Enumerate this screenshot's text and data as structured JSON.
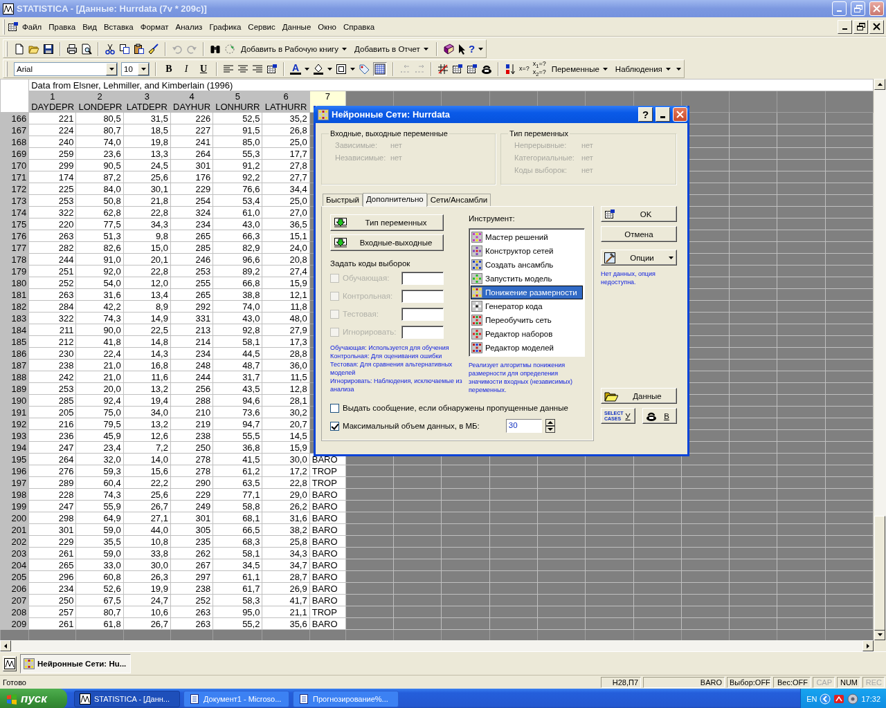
{
  "window": {
    "title": "STATISTICA - [Данные: Hurrdata (7v * 209c)]"
  },
  "menu": [
    "Файл",
    "Правка",
    "Вид",
    "Вставка",
    "Формат",
    "Анализ",
    "Графика",
    "Сервис",
    "Данные",
    "Окно",
    "Справка"
  ],
  "toolbar": {
    "add_to_workbook": "Добавить в Рабочую книгу",
    "add_to_report": "Добавить в Отчет",
    "help_mark": "?",
    "font": "Arial",
    "font_size": "10",
    "format_buttons": [
      "B",
      "I",
      "U"
    ],
    "font_color_letter": "A",
    "gridlines": {
      "on": true
    },
    "formula_buttons": [
      "x=?",
      "x$_{1}$=?",
      "x$_{2}$=?"
    ],
    "variables": "Переменные",
    "cases": "Наблюдения"
  },
  "sheet": {
    "caption": "Data from Elsner, Lehmiller, and Kimberlain (1996)",
    "columns": [
      {
        "number": "1",
        "name": "DAYDEPR"
      },
      {
        "number": "2",
        "name": "LONDEPR"
      },
      {
        "number": "3",
        "name": "LATDEPR"
      },
      {
        "number": "4",
        "name": "DAYHUR"
      },
      {
        "number": "5",
        "name": "LONHURR"
      },
      {
        "number": "6",
        "name": "LATHURR"
      },
      {
        "number": "7",
        "selected": true
      }
    ],
    "rows": [
      {
        "label": "166",
        "cells": [
          "221",
          "80,5",
          "31,5",
          "226",
          "52,5",
          "35,2"
        ]
      },
      {
        "label": "167",
        "cells": [
          "224",
          "80,7",
          "18,5",
          "227",
          "91,5",
          "26,8"
        ]
      },
      {
        "label": "168",
        "cells": [
          "240",
          "74,0",
          "19,8",
          "241",
          "85,0",
          "25,0"
        ]
      },
      {
        "label": "169",
        "cells": [
          "259",
          "23,6",
          "13,3",
          "264",
          "55,3",
          "17,7"
        ]
      },
      {
        "label": "170",
        "cells": [
          "299",
          "90,5",
          "24,5",
          "301",
          "91,2",
          "27,8"
        ]
      },
      {
        "label": "171",
        "cells": [
          "174",
          "87,2",
          "25,6",
          "176",
          "92,2",
          "27,7"
        ]
      },
      {
        "label": "172",
        "cells": [
          "225",
          "84,0",
          "30,1",
          "229",
          "76,6",
          "34,4"
        ]
      },
      {
        "label": "173",
        "cells": [
          "253",
          "50,8",
          "21,8",
          "254",
          "53,4",
          "25,0"
        ]
      },
      {
        "label": "174",
        "cells": [
          "322",
          "62,8",
          "22,8",
          "324",
          "61,0",
          "27,0"
        ]
      },
      {
        "label": "175",
        "cells": [
          "220",
          "77,5",
          "34,3",
          "234",
          "43,0",
          "36,5"
        ]
      },
      {
        "label": "176",
        "cells": [
          "263",
          "51,3",
          "9,8",
          "265",
          "66,3",
          "15,1"
        ]
      },
      {
        "label": "177",
        "cells": [
          "282",
          "82,6",
          "15,0",
          "285",
          "82,9",
          "24,0"
        ]
      },
      {
        "label": "178",
        "cells": [
          "244",
          "91,0",
          "20,1",
          "246",
          "96,6",
          "20,8"
        ]
      },
      {
        "label": "179",
        "cells": [
          "251",
          "92,0",
          "22,8",
          "253",
          "89,2",
          "27,4"
        ]
      },
      {
        "label": "180",
        "cells": [
          "252",
          "54,0",
          "12,0",
          "255",
          "66,8",
          "15,9"
        ]
      },
      {
        "label": "181",
        "cells": [
          "263",
          "31,6",
          "13,4",
          "265",
          "38,8",
          "12,1"
        ]
      },
      {
        "label": "182",
        "cells": [
          "284",
          "42,2",
          "8,9",
          "292",
          "74,0",
          "11,8"
        ]
      },
      {
        "label": "183",
        "cells": [
          "322",
          "74,3",
          "14,9",
          "331",
          "43,0",
          "48,0"
        ]
      },
      {
        "label": "184",
        "cells": [
          "211",
          "90,0",
          "22,5",
          "213",
          "92,8",
          "27,9"
        ]
      },
      {
        "label": "185",
        "cells": [
          "212",
          "41,8",
          "14,8",
          "214",
          "58,1",
          "17,3"
        ]
      },
      {
        "label": "186",
        "cells": [
          "230",
          "22,4",
          "14,3",
          "234",
          "44,5",
          "28,8"
        ]
      },
      {
        "label": "187",
        "cells": [
          "238",
          "21,0",
          "16,8",
          "248",
          "48,7",
          "36,0"
        ]
      },
      {
        "label": "188",
        "cells": [
          "242",
          "21,0",
          "11,6",
          "244",
          "31,7",
          "11,5"
        ]
      },
      {
        "label": "189",
        "cells": [
          "253",
          "20,0",
          "13,2",
          "256",
          "43,5",
          "12,8"
        ]
      },
      {
        "label": "190",
        "cells": [
          "285",
          "92,4",
          "19,4",
          "288",
          "94,6",
          "28,1"
        ]
      },
      {
        "label": "191",
        "cells": [
          "205",
          "75,0",
          "34,0",
          "210",
          "73,6",
          "30,2"
        ]
      },
      {
        "label": "192",
        "cells": [
          "216",
          "79,5",
          "13,2",
          "219",
          "94,7",
          "20,7"
        ]
      },
      {
        "label": "193",
        "cells": [
          "236",
          "45,9",
          "12,6",
          "238",
          "55,5",
          "14,5"
        ]
      },
      {
        "label": "194",
        "cells": [
          "247",
          "23,4",
          "7,2",
          "250",
          "36,8",
          "15,9"
        ]
      },
      {
        "label": "195",
        "cells": [
          "264",
          "32,0",
          "14,0",
          "278",
          "41,5",
          "30,0",
          "BARO"
        ]
      },
      {
        "label": "196",
        "cells": [
          "276",
          "59,3",
          "15,6",
          "278",
          "61,2",
          "17,2",
          "TROP"
        ]
      },
      {
        "label": "197",
        "cells": [
          "289",
          "60,4",
          "22,2",
          "290",
          "63,5",
          "22,8",
          "TROP"
        ]
      },
      {
        "label": "198",
        "cells": [
          "228",
          "74,3",
          "25,6",
          "229",
          "77,1",
          "29,0",
          "BARO"
        ]
      },
      {
        "label": "199",
        "cells": [
          "247",
          "55,9",
          "26,7",
          "249",
          "58,8",
          "26,2",
          "BARO"
        ]
      },
      {
        "label": "200",
        "cells": [
          "298",
          "64,9",
          "27,1",
          "301",
          "68,1",
          "31,6",
          "BARO"
        ]
      },
      {
        "label": "201",
        "cells": [
          "301",
          "59,0",
          "44,0",
          "305",
          "66,5",
          "38,2",
          "BARO"
        ]
      },
      {
        "label": "202",
        "cells": [
          "229",
          "35,5",
          "10,8",
          "235",
          "68,3",
          "25,8",
          "BARO"
        ]
      },
      {
        "label": "203",
        "cells": [
          "261",
          "59,0",
          "33,8",
          "262",
          "58,1",
          "34,3",
          "BARO"
        ]
      },
      {
        "label": "204",
        "cells": [
          "265",
          "33,0",
          "30,0",
          "267",
          "34,5",
          "34,7",
          "BARO"
        ]
      },
      {
        "label": "205",
        "cells": [
          "296",
          "60,8",
          "26,3",
          "297",
          "61,1",
          "28,7",
          "BARO"
        ]
      },
      {
        "label": "206",
        "cells": [
          "234",
          "52,6",
          "19,9",
          "238",
          "61,7",
          "26,9",
          "BARO"
        ]
      },
      {
        "label": "207",
        "cells": [
          "250",
          "67,5",
          "24,7",
          "252",
          "58,3",
          "41,7",
          "BARO"
        ]
      },
      {
        "label": "208",
        "cells": [
          "257",
          "80,7",
          "10,6",
          "263",
          "95,0",
          "21,1",
          "TROP"
        ]
      },
      {
        "label": "209",
        "cells": [
          "261",
          "61,8",
          "26,7",
          "263",
          "55,2",
          "35,6",
          "BARO"
        ]
      }
    ]
  },
  "dialog": {
    "title": "Нейронные Сети: Hurrdata",
    "help_button": "?",
    "io_group": {
      "title": "Входные, выходные переменные",
      "fields": [
        {
          "label": "Зависимые:",
          "value": "нет",
          "disabled": true
        },
        {
          "label": "Независимые:",
          "value": "нет",
          "disabled": true
        }
      ]
    },
    "type_group": {
      "title": "Тип переменных",
      "fields": [
        {
          "label": "Непрерывные:",
          "value": "нет",
          "disabled": true
        },
        {
          "label": "Категориальные:",
          "value": "нет",
          "disabled": true
        },
        {
          "label": "Коды выборок:",
          "value": "нет",
          "disabled": true
        }
      ]
    },
    "tabs": [
      {
        "label": "Быстрый",
        "selected": false
      },
      {
        "label": "Дополнительно",
        "selected": true
      },
      {
        "label": "Сети/Ансамбли",
        "selected": false
      }
    ],
    "left_buttons": [
      "Тип переменных",
      "Входные-выходные"
    ],
    "sample_codes": {
      "title": "Задать коды выборок",
      "items": [
        {
          "label": "Обучающая:",
          "checked": false,
          "disabled": true
        },
        {
          "label": "Контрольная:",
          "checked": false,
          "disabled": true
        },
        {
          "label": "Тестовая:",
          "checked": false,
          "disabled": true
        },
        {
          "label": "Игнорировать:",
          "checked": false,
          "disabled": true
        }
      ]
    },
    "notes": [
      "Обучающая: Используется для обучения",
      "Контрольная: Для оценивания ошибки",
      "Тестовая: Для сравнения альтернативных моделей",
      "Игнорировать: Наблюдения, исключаемые из анализа"
    ],
    "tool_label": "Инструмент:",
    "tools": [
      {
        "label": "Мастер решений",
        "selected": false
      },
      {
        "label": "Конструктор сетей",
        "selected": false
      },
      {
        "label": "Создать ансамбль",
        "selected": false
      },
      {
        "label": "Запустить модель",
        "selected": false
      },
      {
        "label": "Понижение размерности",
        "selected": true
      },
      {
        "label": "Генератор кода",
        "selected": false
      },
      {
        "label": "Переобучить сеть",
        "selected": false
      },
      {
        "label": "Редактор наборов",
        "selected": false
      },
      {
        "label": "Редактор моделей",
        "selected": false
      }
    ],
    "tool_description": "Реализует алгоритмы понижения размерности для определения значимости входных (независимых) переменных.",
    "options": [
      {
        "label": "Выдать сообщение, если обнаружены пропущенные данные",
        "checked": false
      },
      {
        "label": "Максимальный объем данных, в МБ:",
        "checked": true,
        "value": "30"
      }
    ],
    "actions": {
      "ok": "OK",
      "cancel": "Отмена",
      "options": "Опции",
      "unavailable_note": "Нет данных, опция недоступна.",
      "data": "Данные",
      "select_cases_label": "SELECT CASES",
      "select_cases_key": "У",
      "weight_key": "В"
    }
  },
  "mdi_windows": [
    {
      "label": "Нейронные Сети: Hu...",
      "selected": true
    }
  ],
  "status_bar": {
    "text": "Готово",
    "panels": [
      {
        "text": "H28,П7",
        "disabled": false
      },
      {
        "text": "BARO",
        "disabled": false
      },
      {
        "text": "Выбор:OFF",
        "disabled": false
      },
      {
        "text": "Вес:OFF",
        "disabled": false
      },
      {
        "text": "CAP",
        "disabled": true
      },
      {
        "text": "NUM",
        "disabled": false
      },
      {
        "text": "REC",
        "disabled": true
      }
    ]
  },
  "taskbar": {
    "start": "пуск",
    "tasks": [
      {
        "label": "STATISTICA - [Данн...",
        "selected": true
      },
      {
        "label": "Документ1 - Microso...",
        "selected": false
      },
      {
        "label": "Прогнозирование%...",
        "selected": false
      }
    ],
    "language": "EN",
    "clock": "17:32"
  }
}
